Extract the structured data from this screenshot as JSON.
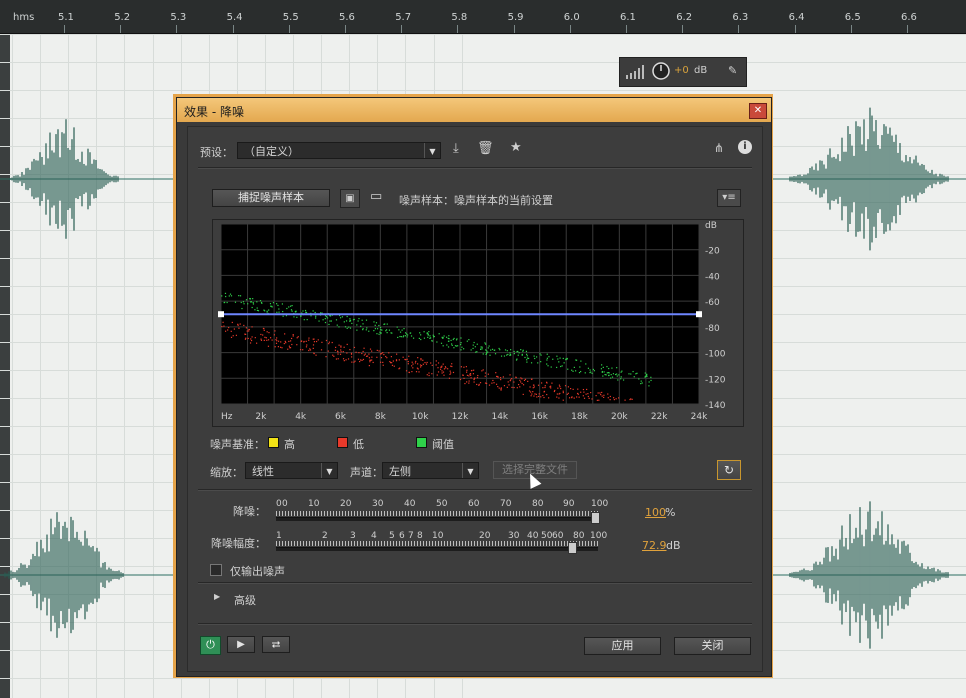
{
  "timeline": {
    "unit_label": "hms",
    "ticks": [
      "5.1",
      "5.2",
      "5.3",
      "5.4",
      "5.5",
      "5.6",
      "5.7",
      "5.8",
      "5.9",
      "6.0",
      "6.1",
      "6.2",
      "6.3",
      "6.4",
      "6.5",
      "6.6"
    ]
  },
  "floating_toolbar": {
    "gain_value": "+0",
    "gain_unit": "dB"
  },
  "dialog": {
    "title": "效果 - 降噪",
    "preset_label": "预设：",
    "preset_value": "（自定义）",
    "capture_button": "捕捉噪声样本",
    "noise_sample_label": "噪声样本：噪声样本的当前设置",
    "graph": {
      "x_ticks": [
        "Hz",
        "2k",
        "4k",
        "6k",
        "8k",
        "10k",
        "12k",
        "14k",
        "16k",
        "18k",
        "20k",
        "22k",
        "24k"
      ],
      "y_ticks": [
        "dB",
        "-20",
        "-40",
        "-60",
        "-80",
        "-100",
        "-120",
        "-140"
      ],
      "threshold_db": -70
    },
    "legend": {
      "title": "噪声基准：",
      "items": [
        {
          "label": "高",
          "color": "#f2e216"
        },
        {
          "label": "低",
          "color": "#e8392a"
        },
        {
          "label": "阈值",
          "color": "#2fd14a"
        }
      ]
    },
    "scale_label": "缩放：",
    "scale_value": "线性",
    "channel_label": "声道：",
    "channel_value": "左侧",
    "select_file_button": "选择完整文件",
    "reduction": {
      "label": "降噪：",
      "ticks": [
        "0",
        "0",
        "10",
        "20",
        "30",
        "40",
        "50",
        "60",
        "70",
        "80",
        "90",
        "100"
      ],
      "value": "100",
      "unit": "%",
      "fraction": 1.0
    },
    "amount": {
      "label": "降噪幅度：",
      "ticks": [
        "1",
        "2",
        "3",
        "4",
        "5",
        "6",
        "7",
        "8",
        "10",
        "20",
        "30",
        "40",
        "50",
        "60",
        "80",
        "100"
      ],
      "value": "72.9",
      "unit": "dB",
      "fraction": 0.93
    },
    "output_noise_only": "仅输出噪声",
    "advanced": "高级",
    "apply_button": "应用",
    "close_button": "关闭"
  }
}
